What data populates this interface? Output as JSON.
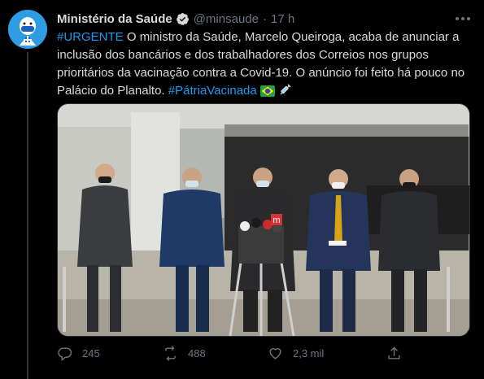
{
  "tweet": {
    "display_name": "Ministério da Saúde",
    "handle": "@minsaude",
    "separator": "·",
    "time": "17 h",
    "text_parts": {
      "hashtag_urgente": "#URGENTE",
      "body": " O ministro da Saúde, Marcelo Queiroga, acaba de anunciar a inclusão dos bancários e dos trabalhadores dos Correios nos grupos prioritários da vacinação contra a Covid-19. O anúncio foi feito há pouco no Palácio do Planalto. ",
      "hashtag_patria": "#PátriaVacinada"
    },
    "emojis": [
      "brazil-flag-icon",
      "syringe-icon"
    ],
    "media": {
      "description_icons": [
        "podium-icon",
        "microphone-icon"
      ],
      "mic_label": "m"
    },
    "actions": {
      "reply_count": "245",
      "retweet_count": "488",
      "like_count": "2,3 mil",
      "share_count": ""
    }
  },
  "colors": {
    "background": "#000000",
    "text": "#d9d9d9",
    "muted": "#6e767d",
    "accent": "#1d9bf0",
    "avatar_bg": "#2f9be3"
  }
}
